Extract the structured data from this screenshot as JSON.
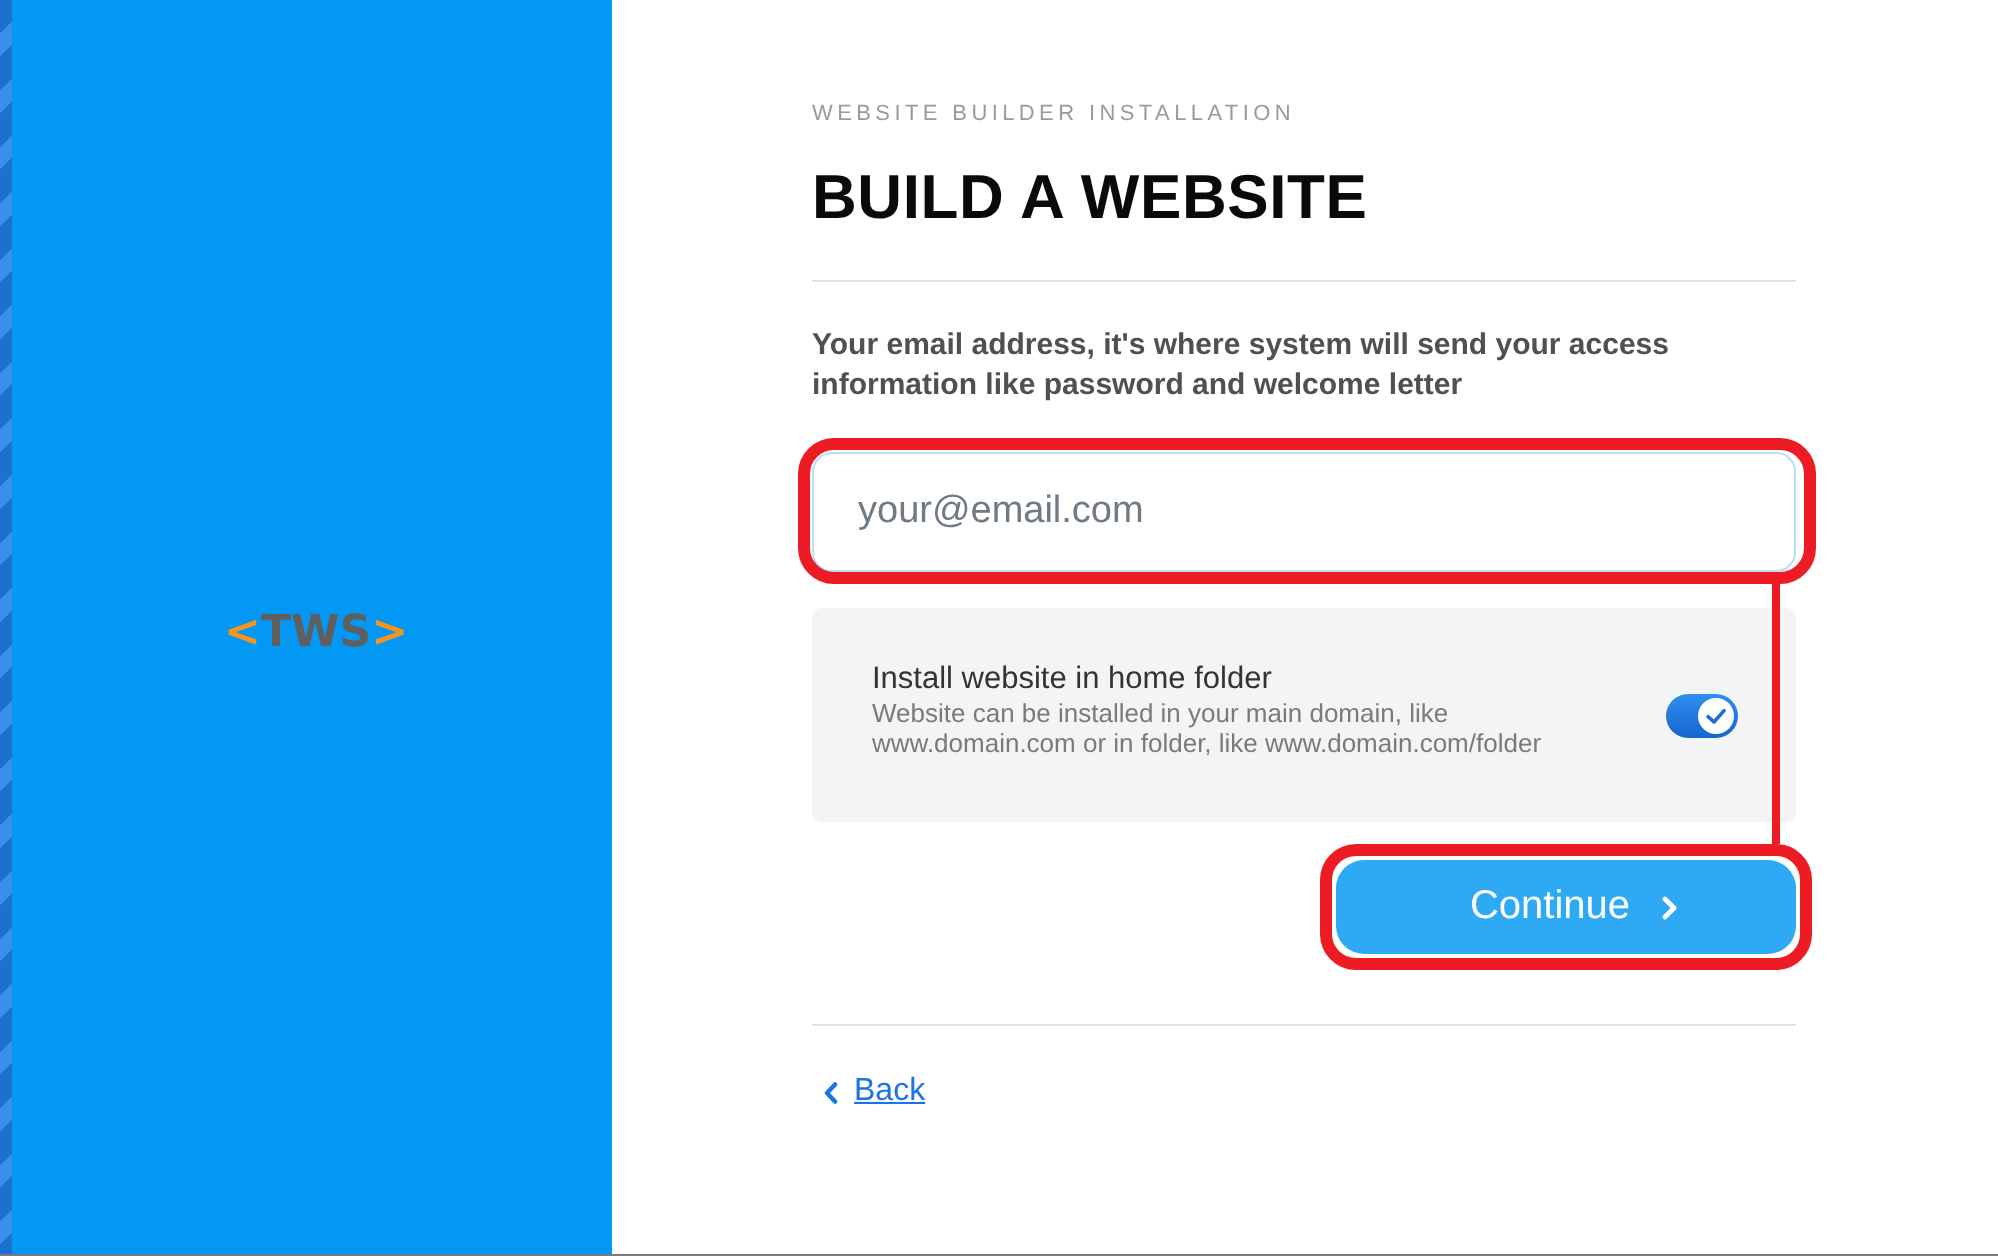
{
  "sidebar": {
    "logo": {
      "open_bracket": "<",
      "text": "TWS",
      "close_bracket": ">"
    }
  },
  "header": {
    "eyebrow": "WEBSITE BUILDER INSTALLATION",
    "title": "BUILD A WEBSITE"
  },
  "email": {
    "description": "Your email address, it's where system will send your access information like password and welcome letter",
    "placeholder": "your@email.com",
    "highlighted": true
  },
  "home_folder_option": {
    "label": "Install website in home folder",
    "description": "Website can be installed in your main domain, like www.domain.com or in folder, like www.domain.com/folder",
    "on": true
  },
  "continue_button": {
    "label": "Continue",
    "highlighted": true
  },
  "annotation_connector": true,
  "back_link": {
    "label": "Back"
  }
}
